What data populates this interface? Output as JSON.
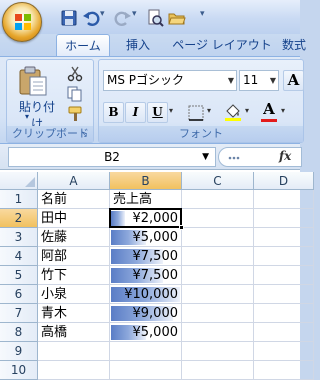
{
  "ribbon_tabs": [
    {
      "label": "ホーム",
      "active": true
    },
    {
      "label": "挿入",
      "active": false
    },
    {
      "label": "ページ レイアウト",
      "active": false
    },
    {
      "label": "数式",
      "active": false
    }
  ],
  "clipboard": {
    "paste_label": "貼り付け",
    "group_label": "クリップボード"
  },
  "font": {
    "font_name": "MS Pゴシック",
    "font_size": "11",
    "grow_label": "A",
    "bold": "B",
    "italic": "I",
    "underline": "U",
    "font_color_label": "A",
    "group_label": "フォント"
  },
  "formula_bar": {
    "name_box": "B2",
    "fx_label": "fx"
  },
  "sheet": {
    "columns": [
      "A",
      "B",
      "C",
      "D"
    ],
    "selected_column": "B",
    "selected_row": 2,
    "rows": [
      {
        "num": "1",
        "a": "名前",
        "b": "売上高",
        "bar": null
      },
      {
        "num": "2",
        "a": "田中",
        "b": "¥2,000",
        "bar": 0.2
      },
      {
        "num": "3",
        "a": "佐藤",
        "b": "¥5,000",
        "bar": 0.5
      },
      {
        "num": "4",
        "a": "阿部",
        "b": "¥7,500",
        "bar": 0.75
      },
      {
        "num": "5",
        "a": "竹下",
        "b": "¥7,500",
        "bar": 0.75
      },
      {
        "num": "6",
        "a": "小泉",
        "b": "¥10,000",
        "bar": 1.0
      },
      {
        "num": "7",
        "a": "青木",
        "b": "¥9,000",
        "bar": 0.9
      },
      {
        "num": "8",
        "a": "高橋",
        "b": "¥5,000",
        "bar": 0.5
      },
      {
        "num": "9",
        "a": "",
        "b": "",
        "bar": null
      },
      {
        "num": "10",
        "a": "",
        "b": "",
        "bar": null
      },
      {
        "num": "11",
        "a": "",
        "b": "",
        "bar": null
      }
    ]
  }
}
